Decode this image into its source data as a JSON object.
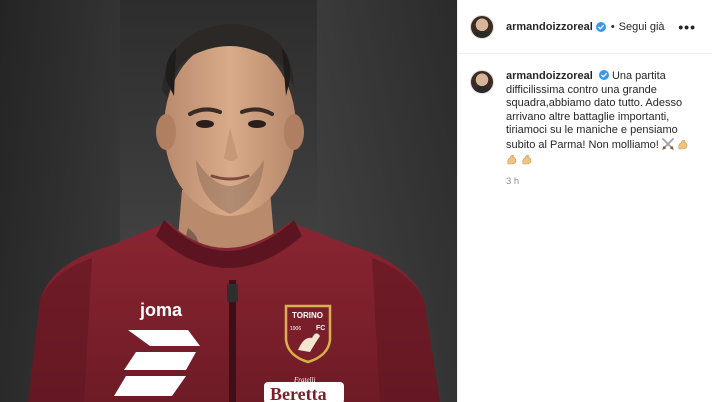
{
  "post": {
    "author": {
      "username": "armandoizzoreal",
      "verified": true,
      "follow_state": "Segui già"
    },
    "more_icon": "more-horizontal-icon",
    "caption": {
      "text_line": "Una partita difficilissima contro una grande squadra,abbiamo dato tutto. Adesso arrivano altre battaglie importanti, tiriamoci su le maniche e pensiamo subito al Parma! Non molliamo!",
      "trailing_emojis": [
        "crossed-swords-emoji",
        "flexed-biceps-emoji",
        "flexed-biceps-emoji",
        "flexed-biceps-emoji"
      ]
    },
    "timestamp": "3 h",
    "photo": {
      "jersey_brand": "joma",
      "sponsor_top": "Fratelli",
      "sponsor_main": "Beretta",
      "crest_top": "TORINO",
      "crest_year": "1906",
      "crest_fc": "FC",
      "colors": {
        "jersey": "#7a1f2a",
        "jersey_dark": "#5c1520",
        "crest_gold": "#d9b04a",
        "verified_blue": "#3897f0"
      }
    }
  }
}
